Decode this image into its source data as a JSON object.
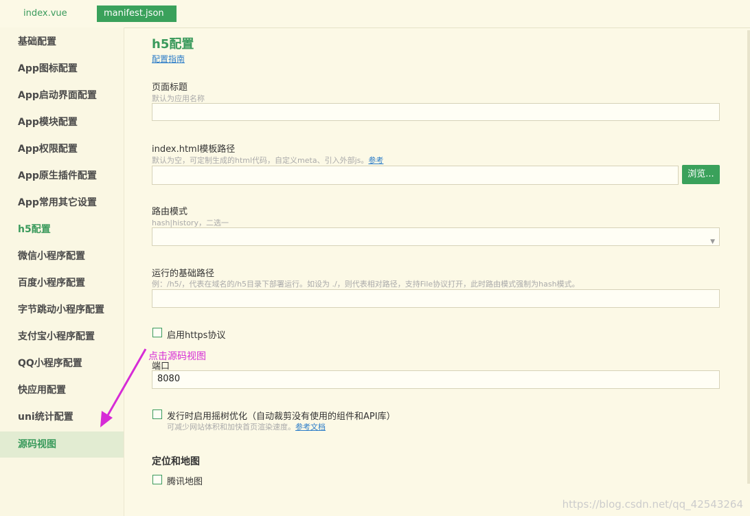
{
  "tabs": [
    {
      "label": "index.vue"
    },
    {
      "label": "manifest.json"
    }
  ],
  "sidebar": {
    "items": [
      {
        "label": "基础配置"
      },
      {
        "label": "App图标配置"
      },
      {
        "label": "App启动界面配置"
      },
      {
        "label": "App模块配置"
      },
      {
        "label": "App权限配置"
      },
      {
        "label": "App原生插件配置"
      },
      {
        "label": "App常用其它设置"
      },
      {
        "label": "h5配置"
      },
      {
        "label": "微信小程序配置"
      },
      {
        "label": "百度小程序配置"
      },
      {
        "label": "字节跳动小程序配置"
      },
      {
        "label": "支付宝小程序配置"
      },
      {
        "label": "QQ小程序配置"
      },
      {
        "label": "快应用配置"
      },
      {
        "label": "uni统计配置"
      },
      {
        "label": "源码视图"
      }
    ]
  },
  "main": {
    "title": "h5配置",
    "guide_link": "配置指南",
    "page_title": {
      "label": "页面标题",
      "hint": "默认为应用名称",
      "value": ""
    },
    "template": {
      "label": "index.html模板路径",
      "hint": "默认为空，可定制生成的html代码，自定义meta、引入外部js。",
      "hint_link": "参考",
      "value": "",
      "browse": "浏览..."
    },
    "router": {
      "label": "路由模式",
      "hint": "hash|history，二选一",
      "value": ""
    },
    "base_path": {
      "label": "运行的基础路径",
      "hint": "例：/h5/，代表在域名的/h5目录下部署运行。如设为 ./，则代表相对路径，支持File协议打开，此时路由模式强制为hash模式。",
      "value": ""
    },
    "https": {
      "label": "启用https协议",
      "checked": false
    },
    "port": {
      "label": "端口",
      "value": "8080"
    },
    "treeshake": {
      "label": "发行时启用摇树优化（自动裁剪没有使用的组件和API库）",
      "hint": "可减少网站体积和加快首页渲染速度。",
      "hint_link": "参考文档",
      "checked": false
    },
    "location_section": "定位和地图",
    "tencent_map": {
      "label": "腾讯地图",
      "checked": false
    }
  },
  "annotation": "点击源码视图",
  "watermark": "https://blog.csdn.net/qq_42543264",
  "colors": {
    "accent": "#3aa15b",
    "annotation": "#d62bd6",
    "link": "#2b7cc8"
  }
}
